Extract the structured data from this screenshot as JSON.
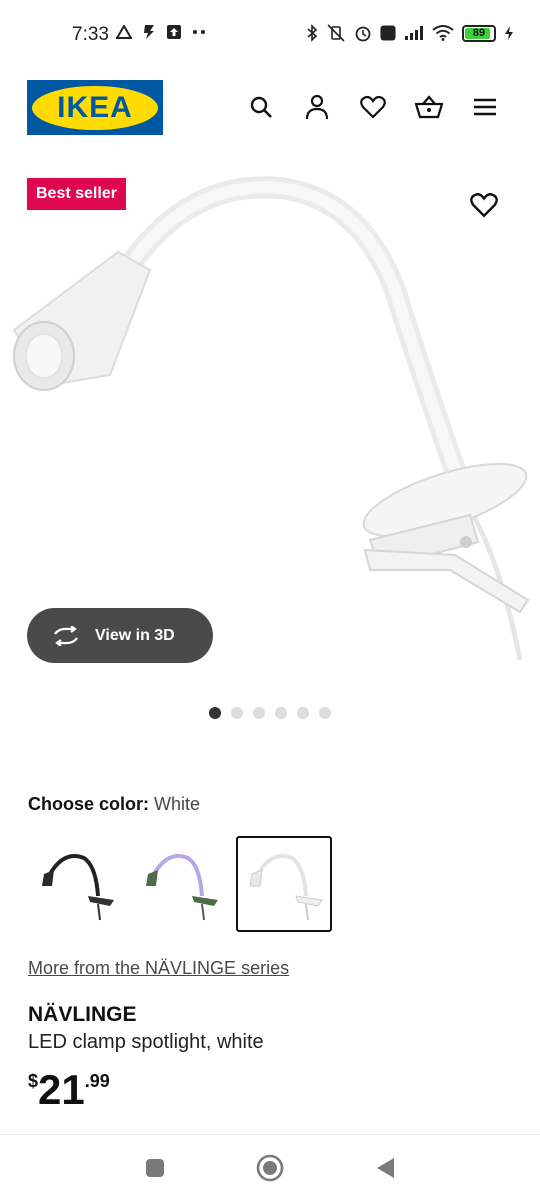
{
  "status_bar": {
    "time": "7:33",
    "battery": "89",
    "battery_level": 0.89
  },
  "header": {
    "logo_text": "IKEA",
    "icons": [
      "search-icon",
      "account-icon",
      "heart-icon",
      "basket-icon",
      "menu-icon"
    ]
  },
  "hero": {
    "badge": "Best seller",
    "view3d_label": "View in 3D",
    "image_count": 6,
    "active_image": 1
  },
  "color": {
    "label": "Choose color:",
    "value": "White",
    "options": [
      "Black",
      "Green/Lilac",
      "White"
    ],
    "selected_index": 2
  },
  "product": {
    "series_link": "More from the NÄVLINGE series",
    "name": "NÄVLINGE",
    "description": "LED clamp spotlight, white",
    "price_currency": "$",
    "price_integer": "21",
    "price_decimal": ".99"
  },
  "colors": {
    "badge": "#e00751",
    "ikea_blue": "#0058a3",
    "ikea_yellow": "#ffdb00",
    "view3d_bg": "#4a4a4a"
  }
}
